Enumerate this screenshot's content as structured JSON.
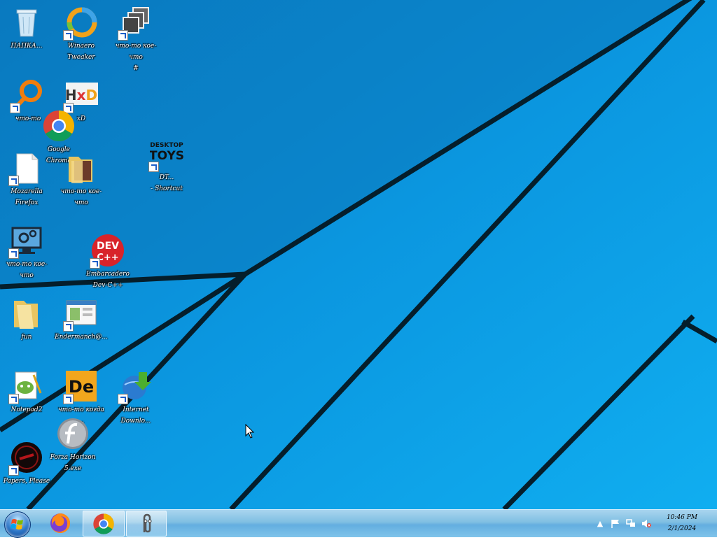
{
  "desktop": {
    "icons": [
      {
        "label": "ПАПКА...",
        "icon": "recycle-bin-icon",
        "shortcut": false
      },
      {
        "label": "Winaero\nTweaker",
        "icon": "winaero-tweaker-icon",
        "shortcut": true
      },
      {
        "label": "что-то кое-что\n#",
        "icon": "stacked-windows-icon",
        "shortcut": true
      },
      {
        "label": "что-то",
        "icon": "search-ring-icon",
        "shortcut": true
      },
      {
        "label": "xD",
        "icon": "hxd-icon",
        "shortcut": true
      },
      {
        "label": "Google\nChrome",
        "icon": "chrome-icon",
        "shortcut": false
      },
      {
        "label": "Mozarella\nFirefox",
        "icon": "blank-document-icon",
        "shortcut": true
      },
      {
        "label": "что-то кое-что",
        "icon": "folder-icon",
        "shortcut": false
      },
      {
        "label": "DT...\n- Shortcut",
        "icon": "desktop-toys-icon",
        "shortcut": true
      },
      {
        "label": "что-то кое-что",
        "icon": "monitor-gear-icon",
        "shortcut": true
      },
      {
        "label": "Embarcadero\nDev-C++",
        "icon": "dev-cpp-icon",
        "shortcut": true
      },
      {
        "label": "fun",
        "icon": "folder-icon",
        "shortcut": false
      },
      {
        "label": "Endermanch@...",
        "icon": "window-app-icon",
        "shortcut": true
      },
      {
        "label": "Notepad2",
        "icon": "notepad2-icon",
        "shortcut": true
      },
      {
        "label": "что-то когда\n...",
        "icon": "de-app-icon",
        "shortcut": true
      },
      {
        "label": "Internet\nDownlo...",
        "icon": "internet-download-manager-icon",
        "shortcut": true
      },
      {
        "label": "Forza Horizon\n5.exe",
        "icon": "flash-icon",
        "shortcut": false
      },
      {
        "label": "Papers, Please",
        "icon": "papers-please-icon",
        "shortcut": true
      }
    ]
  },
  "taskbar": {
    "pinned": [
      {
        "name": "Firefox",
        "icon": "firefox-icon"
      },
      {
        "name": "Google Chrome",
        "icon": "chrome-icon"
      },
      {
        "name": "Clippy",
        "icon": "paperclip-icon"
      }
    ],
    "tray": [
      "show-hidden-icons",
      "action-center-flag-icon",
      "network-icon",
      "volume-muted-icon"
    ],
    "clock": {
      "time": "10:46 PM",
      "date": "2/1/2024"
    }
  },
  "colors": {
    "wallpaper": "#0a8fd8",
    "line": "#05202e",
    "taskbar": "#7fbfe2"
  }
}
